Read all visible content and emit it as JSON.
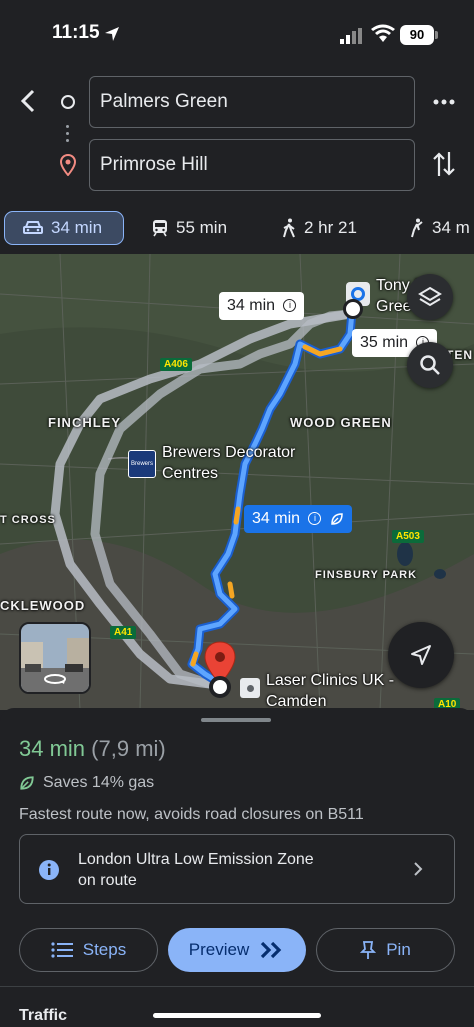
{
  "status": {
    "time": "11:15",
    "battery": "90"
  },
  "directions": {
    "origin": "Palmers Green",
    "destination": "Primrose Hill"
  },
  "modes": [
    {
      "label": "34 min",
      "icon": "car-icon",
      "selected": true
    },
    {
      "label": "55 min",
      "icon": "train-icon",
      "selected": false
    },
    {
      "label": "2 hr 21",
      "icon": "walk-icon",
      "selected": false
    },
    {
      "label": "34 m",
      "icon": "rideshare-icon",
      "selected": false
    }
  ],
  "map": {
    "areas": [
      "FINCHLEY",
      "WOOD GREEN",
      "FINSBURY PARK",
      "CKLEWOOD",
      "T CROSS",
      "TEN"
    ],
    "roads": [
      "A406",
      "A41",
      "A503",
      "A10"
    ],
    "pois": {
      "brewers": "Brewers Decorator Centres",
      "brewers_logo": "Brewers",
      "brewers_line1": "Brewers Decorator",
      "brewers_line2": "Centres",
      "laser_line1": "Laser Clinics UK -",
      "laser_line2": "Camden",
      "tony_line1": "Tony Pa",
      "tony_line2": "Gree"
    },
    "bubbles": {
      "alt1": "34 min",
      "alt2": "35 min",
      "main": "34 min"
    },
    "colors": {
      "route": "#4285f4",
      "alt_route": "#b7bcc4",
      "traffic": "#f5a623"
    }
  },
  "sheet": {
    "duration": "34 min",
    "distance": "(7,9 mi)",
    "gas": "Saves 14% gas",
    "note": "Fastest route now, avoids road closures on B511",
    "ulez_line1": "London Ultra Low Emission Zone",
    "ulez_line2": "on route",
    "buttons": {
      "steps": "Steps",
      "preview": "Preview",
      "pin": "Pin"
    },
    "traffic": "Traffic"
  }
}
